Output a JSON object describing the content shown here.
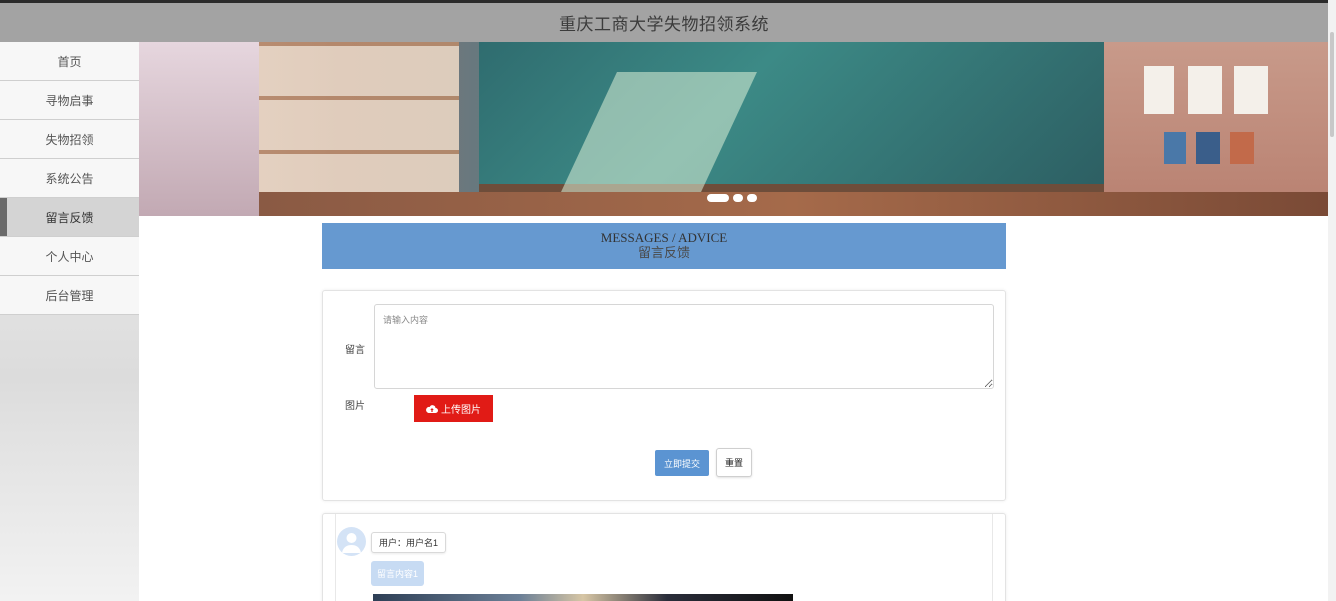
{
  "app": {
    "title": "重庆工商大学失物招领系统"
  },
  "sidebar": {
    "items": [
      {
        "label": "首页"
      },
      {
        "label": "寻物启事"
      },
      {
        "label": "失物招领"
      },
      {
        "label": "系统公告"
      },
      {
        "label": "留言反馈",
        "active": true
      },
      {
        "label": "个人中心"
      },
      {
        "label": "后台管理"
      }
    ]
  },
  "section": {
    "title_en": "MESSAGES / ADVICE",
    "title_cn": "留言反馈"
  },
  "form": {
    "message_label": "留言",
    "message_placeholder": "请输入内容",
    "image_label": "图片",
    "upload_label": "上传图片",
    "submit_label": "立即提交",
    "reset_label": "重置"
  },
  "messages": [
    {
      "user": "用户：用户名1",
      "content": "留言内容1"
    }
  ],
  "colors": {
    "topbar": "#a3a3a3",
    "accent": "#6699d0",
    "upload": "#e11b16",
    "submit": "#5b94d2"
  },
  "icons": {
    "upload": "cloud-upload-icon",
    "avatar": "user-avatar-icon"
  }
}
